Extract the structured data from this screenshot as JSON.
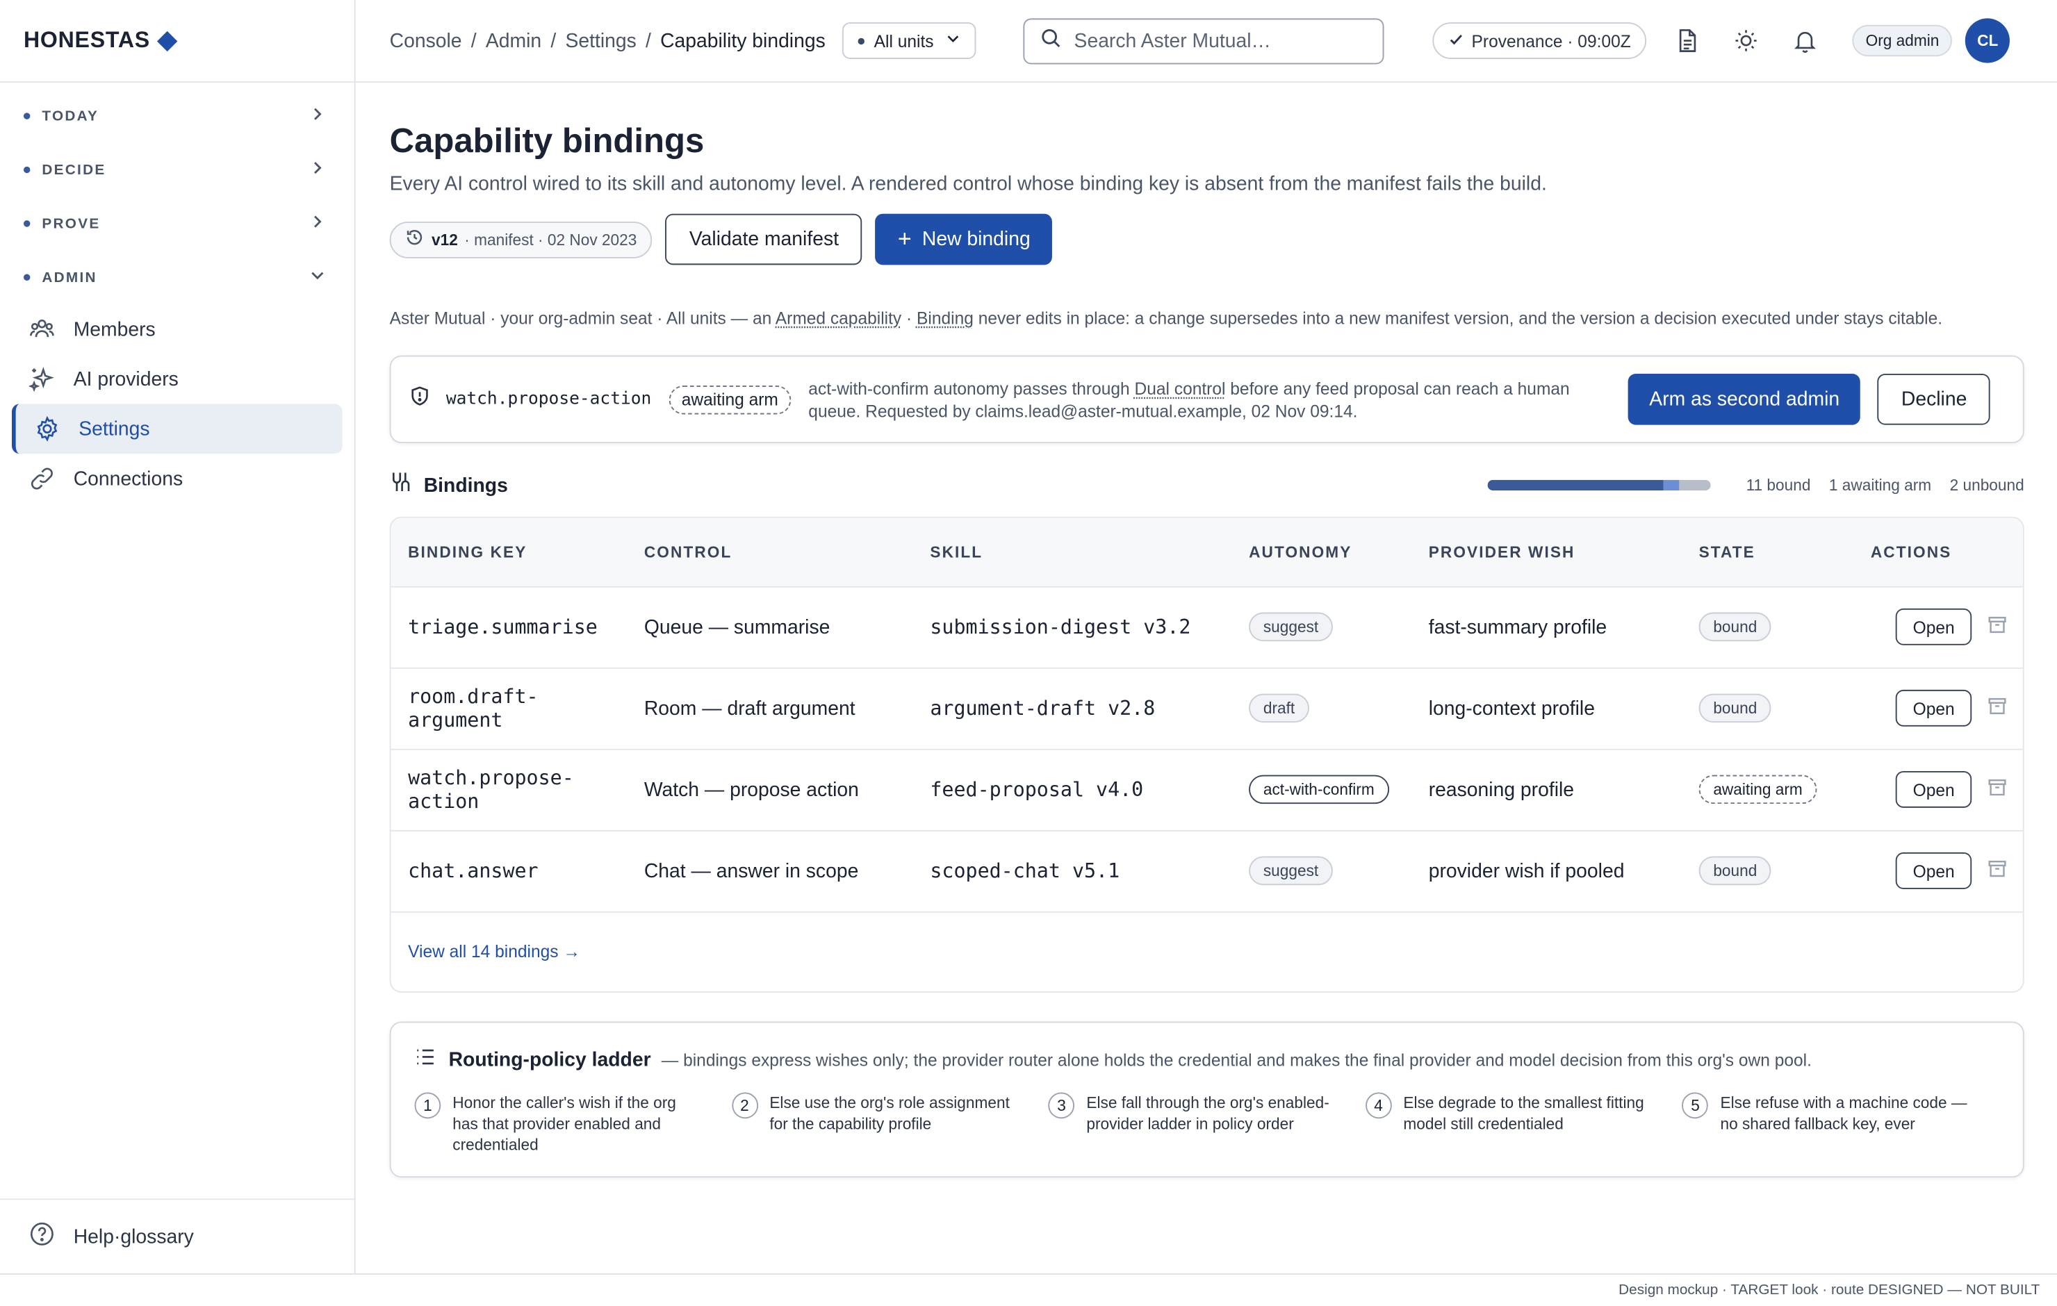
{
  "brand": {
    "name": "HONESTAS"
  },
  "sidebar": {
    "sections": [
      {
        "label": "TODAY"
      },
      {
        "label": "DECIDE"
      },
      {
        "label": "PROVE"
      },
      {
        "label": "ADMIN"
      }
    ],
    "items": [
      {
        "label": "Members",
        "icon": "members-icon"
      },
      {
        "label": "AI providers",
        "icon": "sparkle-icon"
      },
      {
        "label": "Settings",
        "icon": "gear-icon",
        "active": true
      },
      {
        "label": "Connections",
        "icon": "link-icon"
      }
    ],
    "footer": {
      "label": "Help·glossary"
    }
  },
  "topbar": {
    "breadcrumbs": [
      "Console",
      "Admin",
      "Settings",
      "Capability bindings"
    ],
    "unit_select": "All units",
    "search_placeholder": "Search Aster Mutual…",
    "provenance": "Provenance · 09:00Z",
    "role": "Org admin",
    "avatar": "CL"
  },
  "page": {
    "title": "Capability bindings",
    "subtitle": "Every AI control wired to its skill and autonomy level. A rendered control whose binding key is absent from the manifest fails the build.",
    "version": {
      "v": "v12",
      "rest": "· manifest · 02 Nov 2023"
    },
    "validate_label": "Validate manifest",
    "new_label": "New binding",
    "context": {
      "pre": "Aster Mutual · your org-admin seat · All units — an ",
      "link1": "Armed capability",
      "mid": " · ",
      "link2": "Binding",
      "post": " never edits in place: a change supersedes into a new manifest version, and the version a decision executed under stays citable."
    }
  },
  "arm_request": {
    "key": "watch.propose-action",
    "state": "awaiting arm",
    "msg_pre": "act-with-confirm autonomy passes through ",
    "msg_link": "Dual control",
    "msg_post": " before any feed proposal can reach a human queue. Requested by claims.lead@aster-mutual.example, 02 Nov 09:14.",
    "arm_label": "Arm as second admin",
    "decline_label": "Decline"
  },
  "bindings": {
    "title": "Bindings",
    "bound_fraction": 0.786,
    "awaiting_fraction": 0.071,
    "stats": [
      "11 bound",
      "1 awaiting arm",
      "2 unbound"
    ],
    "columns": [
      "BINDING KEY",
      "CONTROL",
      "SKILL",
      "AUTONOMY",
      "PROVIDER WISH",
      "STATE",
      "ACTIONS"
    ],
    "rows": [
      {
        "key": "triage.summarise",
        "control": "Queue — summarise",
        "skill": "submission-digest v3.2",
        "autonomy": "suggest",
        "provider": "fast-summary profile",
        "state": "bound",
        "open": "Open"
      },
      {
        "key": "room.draft-argument",
        "control": "Room — draft argument",
        "skill": "argument-draft v2.8",
        "autonomy": "draft",
        "provider": "long-context profile",
        "state": "bound",
        "open": "Open"
      },
      {
        "key": "watch.propose-action",
        "control": "Watch — propose action",
        "skill": "feed-proposal v4.0",
        "autonomy": "act-with-confirm",
        "provider": "reasoning profile",
        "state": "awaiting arm",
        "open": "Open"
      },
      {
        "key": "chat.answer",
        "control": "Chat — answer in scope",
        "skill": "scoped-chat v5.1",
        "autonomy": "suggest",
        "provider": "provider wish if pooled",
        "state": "bound",
        "open": "Open"
      }
    ],
    "view_all": "View all 14 bindings →"
  },
  "ladder": {
    "title": "Routing-policy ladder",
    "desc": "— bindings express wishes only; the provider router alone holds the credential and makes the final provider and model decision from this org's own pool.",
    "steps": [
      {
        "n": "1",
        "text": "Honor the caller's wish if the org has that provider enabled and credentialed"
      },
      {
        "n": "2",
        "text": "Else use the org's role assignment for the capability profile"
      },
      {
        "n": "3",
        "text": "Else fall through the org's enabled-provider ladder in policy order"
      },
      {
        "n": "4",
        "text": "Else degrade to the smallest fitting model still credentialed"
      },
      {
        "n": "5",
        "text": "Else refuse with a machine code — no shared fallback key, ever"
      }
    ]
  },
  "footer_note": "Design mockup · TARGET look · route DESIGNED — NOT BUILT",
  "colors": {
    "accent": "#1f4fa8",
    "border": "#dde1e8",
    "muted": "#4a5568"
  }
}
